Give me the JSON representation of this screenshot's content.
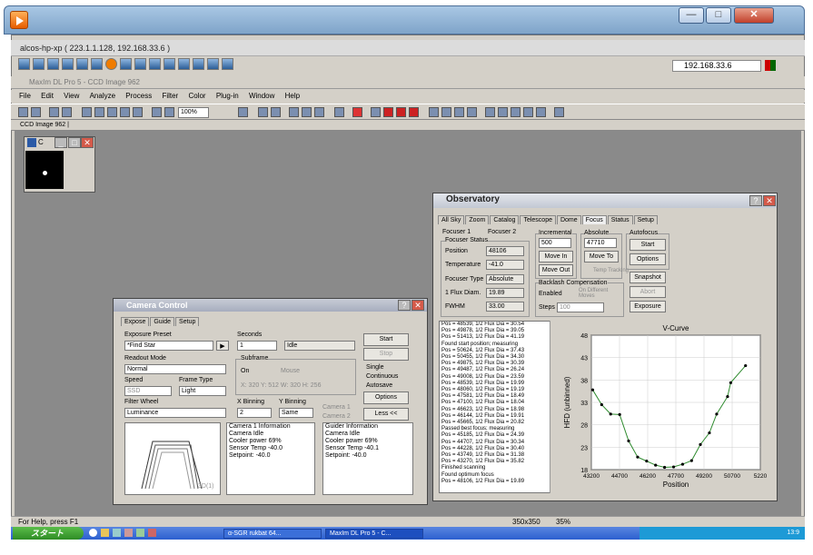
{
  "window": {
    "title": "alcos-hp-xp ( 223.1.1.128, 192.168.33.6 )",
    "ip": "192.168.33.6",
    "app_title": "MaxIm DL Pro 5 - CCD Image 962",
    "doc_tab": "CCD Image 962 |",
    "ccd_small_title": "C"
  },
  "menu": [
    "File",
    "Edit",
    "View",
    "Analyze",
    "Process",
    "Filter",
    "Color",
    "Plug-in",
    "Window",
    "Help"
  ],
  "toolbar": {
    "zoom": "100%"
  },
  "camera": {
    "title": "Camera Control",
    "tabs": [
      "Expose",
      "Guide",
      "Setup"
    ],
    "exposure_preset_label": "Exposure Preset",
    "exposure_preset": "*Find Star",
    "seconds_label": "Seconds",
    "seconds": "1",
    "idle": "Idle",
    "readout_label": "Readout Mode",
    "readout": "Normal",
    "subframe_label": "Subframe",
    "subframe_on": "On",
    "subframe_mouse": "Mouse",
    "subframe_coords": "X: 320 Y: 512 W: 320 H: 256",
    "speed_label": "Speed",
    "speed": "SSD",
    "frame_type_label": "Frame Type",
    "frame_type": "Light",
    "filter_wheel_label": "Filter Wheel",
    "filter": "Luminance",
    "xbin_label": "X Binning",
    "xbin": "2",
    "ybin_label": "Y Binning",
    "ybin": "Same",
    "cam1": "Camera 1",
    "cam2": "Camera 2",
    "single": "Single",
    "continuous": "Continuous",
    "autosave": "Autosave",
    "start": "Start",
    "stop": "Stop",
    "options": "Options",
    "less": "Less <<",
    "graph_label": "3D(1)",
    "cam_info": [
      "Camera 1 Information",
      "Camera Idle",
      "",
      "Cooler power 69%",
      "Sensor Temp -40.0",
      "Setpoint: -40.0"
    ],
    "guider_info": [
      "Guider Information",
      "Camera Idle",
      "",
      "Cooler power 69%",
      "Sensor Temp -40.1",
      "Setpoint: -40.0"
    ]
  },
  "observatory": {
    "title": "Observatory",
    "tabs": [
      "All Sky",
      "Zoom",
      "Catalog",
      "Telescope",
      "Dome",
      "Focus",
      "Status",
      "Setup"
    ],
    "focuser1": "Focuser 1",
    "focuser2": "Focuser 2",
    "status_label": "Focuser Status",
    "position_label": "Position",
    "position": "48106",
    "temperature_label": "Temperature",
    "temperature": "-41.0",
    "focuser_type_label": "Focuser Type",
    "focuser_type": "Absolute",
    "flux_label": "1 Flux Diam.",
    "flux": "19.89",
    "fwhm_label": "FWHM",
    "fwhm": "33.00",
    "incremental_label": "Incremental",
    "incremental": "500",
    "move_in": "Move In",
    "move_out": "Move Out",
    "absolute_label": "Absolute",
    "absolute": "47710",
    "move_to": "Move To",
    "temp_tracking": "Temp Tracking",
    "autofocus_label": "Autofocus",
    "af_start": "Start",
    "af_options": "Options",
    "snapshot": "Snapshot",
    "abort": "Abort",
    "exposure": "Exposure",
    "backlash_label": "Backlash Compensation",
    "enabled": "Enabled",
    "on_different": "On Different Moves",
    "steps_label": "Steps",
    "steps": "100",
    "log": [
      "Pos = 48539, 1/2 Flux Dia = 30.54",
      "Pos = 49878, 1/2 Flux Dia = 39.05",
      "Pos = 51413, 1/2 Flux Dia = 41.19",
      "Found start position; measuring",
      "Pos = 50624, 1/2 Flux Dia = 37.43",
      "Pos = 50455, 1/2 Flux Dia = 34.30",
      "Pos = 49875, 1/2 Flux Dia = 30.39",
      "Pos = 49487, 1/2 Flux Dia = 26.24",
      "Pos = 49008, 1/2 Flux Dia = 23.59",
      "Pos = 48539, 1/2 Flux Dia = 19.99",
      "Pos = 48060, 1/2 Flux Dia = 19.19",
      "Pos = 47581, 1/2 Flux Dia = 18.49",
      "Pos = 47100, 1/2 Flux Dia = 18.04",
      "Pos = 46623, 1/2 Flux Dia = 18.98",
      "Pos = 46144, 1/2 Flux Dia = 19.91",
      "Pos = 45665, 1/2 Flux Dia = 20.82",
      "Passed best focus; measuring",
      "Pos = 45185, 1/2 Flux Dia = 24.39",
      "Pos = 44707, 1/2 Flux Dia = 30.34",
      "Pos = 44228, 1/2 Flux Dia = 30.40",
      "Pos = 43749, 1/2 Flux Dia = 31.38",
      "Pos = 43270, 1/2 Flux Dia = 35.82",
      "Finished scanning",
      "Found optimum focus",
      "Pos = 48106, 1/2 Flux Dia = 19.89"
    ]
  },
  "chart_data": {
    "type": "scatter",
    "title": "V-Curve",
    "xlabel": "Position",
    "ylabel": "HFD (unbinned)",
    "xlim": [
      43200,
      52200
    ],
    "ylim": [
      18,
      48
    ],
    "xticks": [
      "43200",
      "44700",
      "46200",
      "47700",
      "49200",
      "50700",
      "5220"
    ],
    "yticks": [
      18,
      23,
      28,
      33,
      38,
      43,
      48
    ],
    "x": [
      43270,
      43749,
      44228,
      44707,
      45185,
      45665,
      46144,
      46623,
      47100,
      47581,
      48060,
      48539,
      49008,
      49487,
      49875,
      50455,
      50624,
      51413
    ],
    "y": [
      35.8,
      32.5,
      30.4,
      30.3,
      24.4,
      20.8,
      19.9,
      19.0,
      18.5,
      18.6,
      19.2,
      20.0,
      23.6,
      26.2,
      30.4,
      34.3,
      37.4,
      41.2
    ]
  },
  "status": {
    "help": "For Help, press F1",
    "size": "350x350",
    "zoom": "35%"
  },
  "taskbar": {
    "start": "スタート",
    "task1": "α-SGR rukbat   64...",
    "task2": "MaxIm DL Pro 5 - C...",
    "clock": "13:9"
  }
}
